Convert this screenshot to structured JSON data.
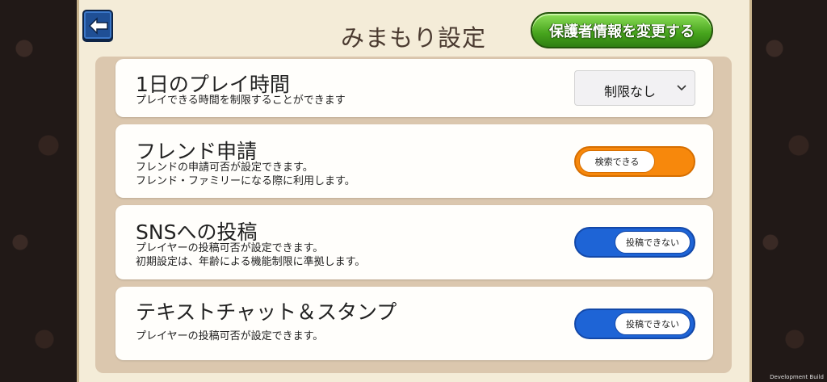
{
  "header": {
    "title": "みまもり設定",
    "change_button": "保護者情報を変更する"
  },
  "settings": [
    {
      "title": "1日のプレイ時間",
      "desc1": "プレイできる時間を制限することができます",
      "desc2": "",
      "control": "select",
      "value": "制限なし"
    },
    {
      "title": "フレンド申請",
      "desc1": "フレンドの申請可否が設定できます。",
      "desc2": "フレンド・ファミリーになる際に利用します。",
      "control": "toggle",
      "state": "on",
      "value": "検索できる"
    },
    {
      "title": "SNSへの投稿",
      "desc1": "プレイヤーの投稿可否が設定できます。",
      "desc2": "初期設定は、年齢による機能制限に準拠します。",
      "control": "toggle",
      "state": "off",
      "value": "投稿できない"
    },
    {
      "title": "テキストチャット＆スタンプ",
      "desc1": "プレイヤーの投稿可否が設定できます。",
      "desc2": "",
      "control": "toggle",
      "state": "off",
      "value": "投稿できない"
    }
  ],
  "footer": {
    "build_label": "Development Build"
  },
  "colors": {
    "toggle_on": "#f7880c",
    "toggle_off": "#1e64d6",
    "button_green": "#46a31c",
    "back_blue": "#1f4f95"
  }
}
